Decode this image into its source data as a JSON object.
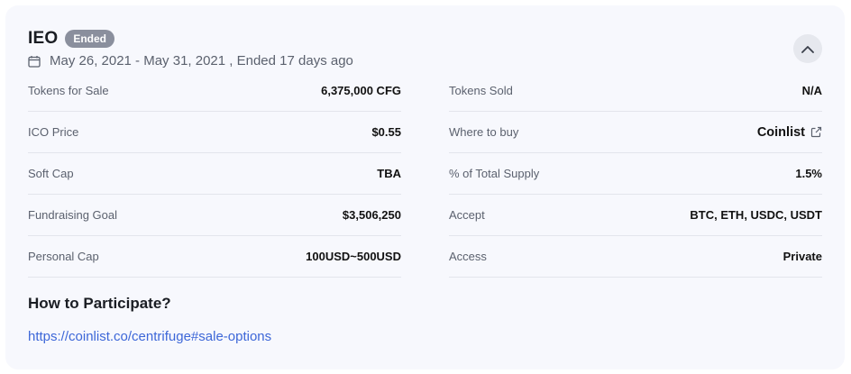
{
  "header": {
    "title": "IEO",
    "status_badge": "Ended",
    "dates": "May 26, 2021 - May 31, 2021 , Ended 17 days ago"
  },
  "left_rows": [
    {
      "label": "Tokens for Sale",
      "value": "6,375,000 CFG"
    },
    {
      "label": "ICO Price",
      "value": "$0.55"
    },
    {
      "label": "Soft Cap",
      "value": "TBA"
    },
    {
      "label": "Fundraising Goal",
      "value": "$3,506,250"
    },
    {
      "label": "Personal Cap",
      "value": "100USD~500USD"
    }
  ],
  "right_rows": [
    {
      "label": "Tokens Sold",
      "value": "N/A"
    },
    {
      "label": "Where to buy",
      "value": "Coinlist"
    },
    {
      "label": "% of Total Supply",
      "value": "1.5%"
    },
    {
      "label": "Accept",
      "value": "BTC, ETH, USDC, USDT"
    },
    {
      "label": "Access",
      "value": "Private"
    }
  ],
  "participate": {
    "heading": "How to Participate?",
    "link": "https://coinlist.co/centrifuge#sale-options"
  },
  "icons": {
    "calendar": "calendar-icon",
    "collapse": "chevron-up-icon",
    "external": "external-link-icon"
  },
  "colors": {
    "card_bg": "#f7f8fd",
    "badge_bg": "#8a8f9d",
    "link": "#3d67d8"
  }
}
